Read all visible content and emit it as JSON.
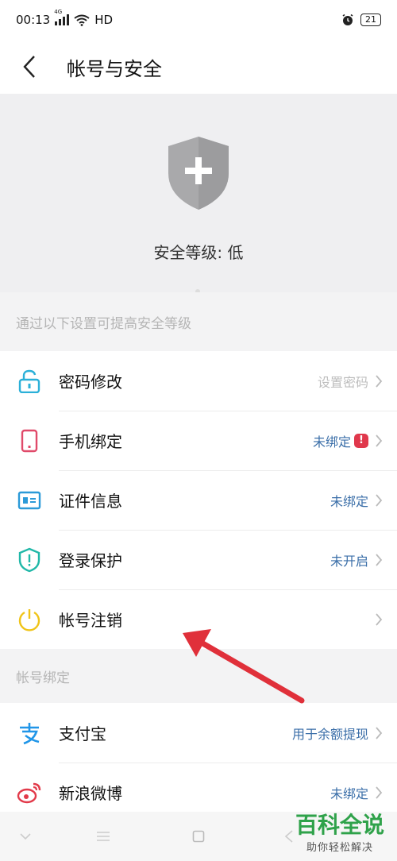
{
  "status": {
    "time": "00:13",
    "net": "HD",
    "signal_label": "4G",
    "battery": "21"
  },
  "header": {
    "title": "帐号与安全"
  },
  "hero": {
    "level_text": "安全等级: 低"
  },
  "sections": {
    "security_hint": "通过以下设置可提高安全等级",
    "binding_title": "帐号绑定"
  },
  "security_items": [
    {
      "label": "密码修改",
      "value": "设置密码"
    },
    {
      "label": "手机绑定",
      "value": "未绑定",
      "badge": "!"
    },
    {
      "label": "证件信息",
      "value": "未绑定"
    },
    {
      "label": "登录保护",
      "value": "未开启"
    },
    {
      "label": "帐号注销",
      "value": ""
    }
  ],
  "binding_items": [
    {
      "label": "支付宝",
      "value": "用于余额提现"
    },
    {
      "label": "新浪微博",
      "value": "未绑定"
    }
  ],
  "watermark": {
    "title": "百科全说",
    "subtitle": "助你轻松解决"
  },
  "colors": {
    "blue_value": "#3a6ea8",
    "badge_red": "#e0384c",
    "arrow_red": "#e0303a",
    "watermark_green": "#2fa24a"
  }
}
